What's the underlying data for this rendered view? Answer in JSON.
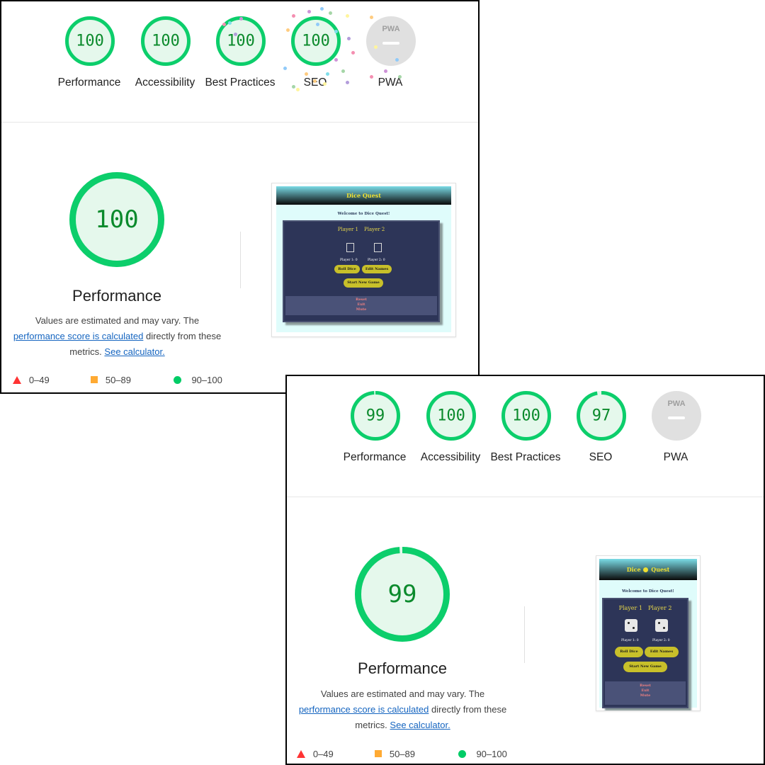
{
  "report_a": {
    "categories": [
      {
        "label": "Performance",
        "score": "100",
        "value": 100
      },
      {
        "label": "Accessibility",
        "score": "100",
        "value": 100
      },
      {
        "label": "Best Practices",
        "score": "100",
        "value": 100
      },
      {
        "label": "SEO",
        "score": "100",
        "value": 100
      },
      {
        "label": "PWA",
        "score": "",
        "value": 0
      }
    ],
    "big_score": "100",
    "big_value": 100
  },
  "report_b": {
    "categories": [
      {
        "label": "Performance",
        "score": "99",
        "value": 99
      },
      {
        "label": "Accessibility",
        "score": "100",
        "value": 100
      },
      {
        "label": "Best Practices",
        "score": "100",
        "value": 100
      },
      {
        "label": "SEO",
        "score": "97",
        "value": 97
      },
      {
        "label": "PWA",
        "score": "",
        "value": 0
      }
    ],
    "big_score": "99",
    "big_value": 99
  },
  "common": {
    "big_title": "Performance",
    "desc_prefix": "Values are estimated and may vary. The",
    "desc_link": "performance score is calculated",
    "desc_middle": "directly from these metrics.",
    "desc_link2": "See calculator.",
    "pwa_badge": "PWA",
    "legend": {
      "fail": "0–49",
      "average": "50–89",
      "pass": "90–100"
    }
  },
  "screenshot": {
    "title_a": "Dice    Quest",
    "title_b": "Dice",
    "title_b2": "Quest",
    "welcome": "Welcome to Dice Quest!",
    "player1": "Player 1",
    "player2": "Player 2",
    "score1": "Player 1: 0",
    "score2": "Player 2: 0",
    "roll": "Roll Dice",
    "edit": "Edit Names",
    "new_game": "Start New Game",
    "reset": "Reset",
    "exit": "Exit",
    "mute": "Mute"
  },
  "colors": {
    "pass": "#0cce6b",
    "pass_fill": "#e5f8ec",
    "pass_text": "#0b8a2c",
    "pwa_gray": "#e0e0e0"
  }
}
